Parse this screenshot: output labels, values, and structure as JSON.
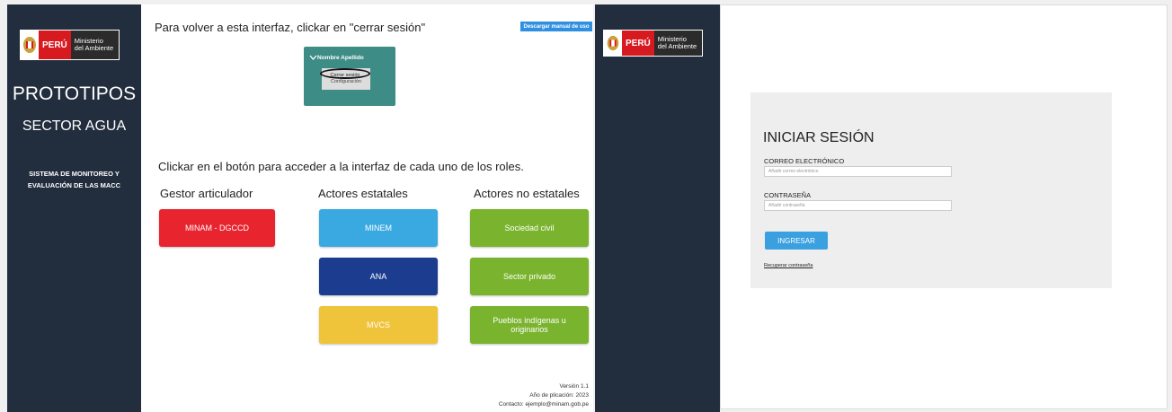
{
  "left_screen": {
    "logo": {
      "peru": "PERÚ",
      "ministry_line1": "Ministerio",
      "ministry_line2": "del Ambiente"
    },
    "sidebar": {
      "title": "PROTOTIPOS",
      "subtitle": "SECTOR AGUA",
      "system_line1": "SISTEMA DE MONITOREO Y",
      "system_line2": "EVALUACIÓN DE LAS MACC"
    },
    "logout_hint": "Para volver a esta interfaz, clickar en \"cerrar sesión\"",
    "manual_button": "Descargar manual de uso",
    "user_menu": {
      "user_name": "Nombre Apellido",
      "items": [
        "Cerrar sesión",
        "Configuración"
      ]
    },
    "instruction": "Clickar en el botón para acceder a la interfaz de cada uno de los roles.",
    "columns": [
      {
        "heading": "Gestor articulador",
        "buttons": [
          {
            "label": "MINAM - DGCCD",
            "color": "#e8242e"
          }
        ]
      },
      {
        "heading": "Actores estatales",
        "buttons": [
          {
            "label": "MINEM",
            "color": "#3aa9e1"
          },
          {
            "label": "ANA",
            "color": "#1c3d8f"
          },
          {
            "label": "MVCS",
            "color": "#efc43a"
          }
        ]
      },
      {
        "heading": "Actores no estatales",
        "buttons": [
          {
            "label": "Sociedad civil",
            "color": "#7ab32e"
          },
          {
            "label": "Sector privado",
            "color": "#7ab32e"
          },
          {
            "label": "Pueblos indígenas u originarios",
            "color": "#7ab32e"
          }
        ]
      }
    ],
    "footer": {
      "version": "Versión 1.1",
      "year": "Año de plicación: 2023",
      "contact": "Contacto: ejemplo@minam.gob.pe"
    }
  },
  "right_screen": {
    "logo": {
      "peru": "PERÚ",
      "ministry_line1": "Ministerio",
      "ministry_line2": "del Ambiente"
    },
    "login": {
      "title": "INICIAR SESIÓN",
      "email_label": "CORREO ELECTRÓNICO",
      "email_placeholder": "Añadir correo electrónico",
      "password_label": "CONTRASEÑA",
      "password_placeholder": "Añadir contraseña",
      "submit": "INGRESAR",
      "recover": "Recuperar contraseña"
    }
  },
  "colors": {
    "sidebar": "#222d3d",
    "menu_teal": "#3e8c86",
    "login_bg": "#eeeeee",
    "login_button": "#3aa0e0"
  }
}
